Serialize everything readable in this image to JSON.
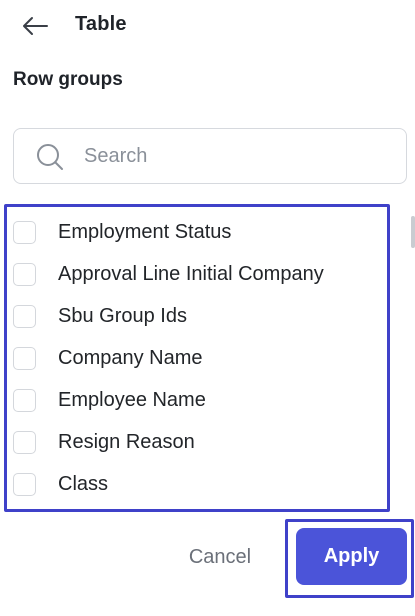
{
  "header": {
    "back_icon": "arrow-left-icon",
    "title": "Table"
  },
  "section": {
    "label": "Row groups"
  },
  "search": {
    "icon": "search-icon",
    "placeholder": "Search",
    "value": ""
  },
  "list": {
    "items": [
      {
        "label": "Employment Status",
        "checked": false
      },
      {
        "label": "Approval Line Initial Company",
        "checked": false
      },
      {
        "label": "Sbu Group Ids",
        "checked": false
      },
      {
        "label": "Company Name",
        "checked": false
      },
      {
        "label": "Employee Name",
        "checked": false
      },
      {
        "label": "Resign Reason",
        "checked": false
      },
      {
        "label": "Class",
        "checked": false
      }
    ]
  },
  "footer": {
    "cancel_label": "Cancel",
    "apply_label": "Apply"
  },
  "colors": {
    "accent": "#4b54d9",
    "highlight_border": "#3f41c9",
    "text": "#1f2329",
    "muted": "#8a9099"
  }
}
